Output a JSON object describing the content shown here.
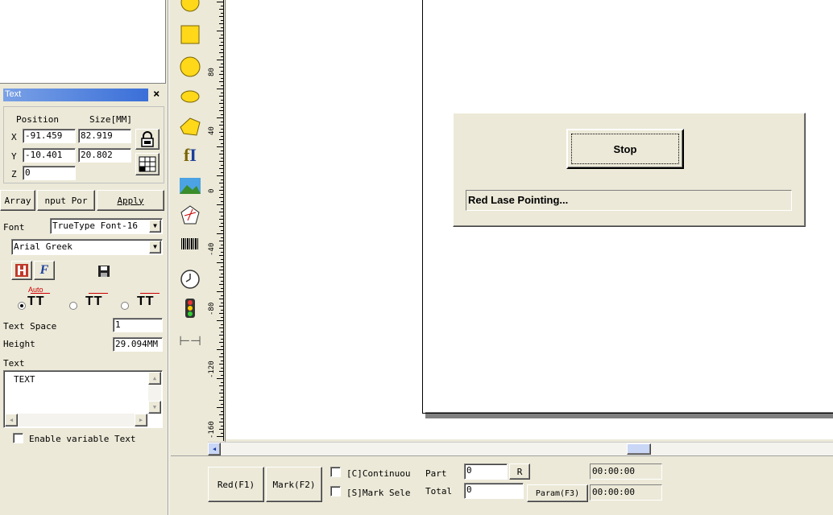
{
  "text_panel": {
    "title": "Text",
    "close": "×",
    "position_label": "Position",
    "size_label": "Size[MM]",
    "x_label": "X",
    "y_label": "Y",
    "z_label": "Z",
    "x_pos": "-91.459",
    "x_size": "82.919",
    "y_pos": "-10.401",
    "y_size": "20.802",
    "z_pos": "0",
    "array_btn": "Array",
    "input_port_btn": "nput Por",
    "apply_btn": "Apply",
    "font_label": "Font",
    "font_type": "TrueType Font-16",
    "font_name": "Arial Greek",
    "auto_label": "Auto",
    "text_space_label": "Text Space",
    "text_space_value": "1",
    "height_label": "Height",
    "height_value": "29.094MM",
    "text_label": "Text",
    "text_value": "TEXT",
    "enable_variable": "Enable variable Text"
  },
  "ruler": {
    "labels": [
      "80",
      "40",
      "0",
      "-40",
      "-80",
      "-120",
      "-160"
    ]
  },
  "dialog": {
    "stop_btn": "Stop",
    "status": "Red Lase Pointing..."
  },
  "bottom": {
    "red_btn": "Red(F1)",
    "mark_btn": "Mark(F2)",
    "continuous": "[C]Continuou",
    "mark_sel": "[S]Mark Sele",
    "part_label": "Part",
    "part_value": "0",
    "total_label": "Total",
    "total_value": "0",
    "r_btn": "R",
    "param_btn": "Param(F3)",
    "time1": "00:00:00",
    "time2": "00:00:00"
  }
}
